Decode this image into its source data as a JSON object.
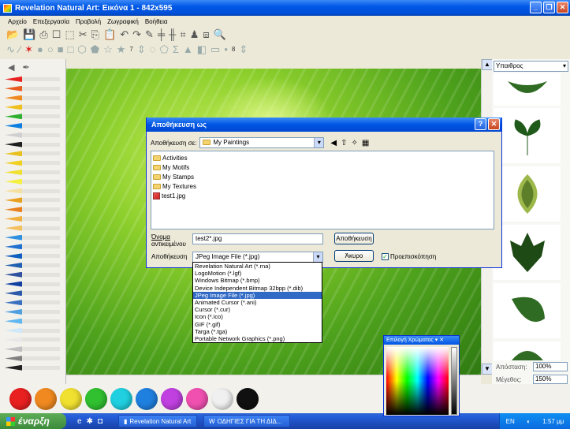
{
  "window": {
    "title": "Revelation Natural Art: Εικόνα 1 - 842x595"
  },
  "menu": [
    "Αρχείο",
    "Επεξεργασία",
    "Προβολή",
    "Ζωγραφική",
    "Βοήθεια"
  ],
  "toolbar2": {
    "spin_value": "7",
    "brush_size": "8"
  },
  "right_panel": {
    "category": "Υπαιθρος",
    "distance_label": "Απόσταση:",
    "distance_value": "100%",
    "size_label": "Μέγεθος:",
    "size_value": "150%"
  },
  "dialog": {
    "title": "Αποθήκευση ως",
    "look_in_label": "Αποθήκευση σε:",
    "look_in_value": "My Paintings",
    "files": [
      {
        "name": "Activities",
        "type": "folder"
      },
      {
        "name": "My Motifs",
        "type": "folder"
      },
      {
        "name": "My Stamps",
        "type": "folder"
      },
      {
        "name": "My Textures",
        "type": "folder"
      },
      {
        "name": "test1.jpg",
        "type": "image"
      }
    ],
    "filename_label_1": "Όνομα",
    "filename_label_2": "αντικειμένου",
    "filename_value": "test2*.jpg",
    "filetype_label": "Αποθήκευση",
    "filetype_value": "JPeg Image File (*.jpg)",
    "save_button": "Αποθήκευση",
    "cancel_button": "Άκυρο",
    "preview_label": "Προεπισκόπηση",
    "preview_checked": true
  },
  "filetype_options": [
    "Revelation Natural Art (*.rna)",
    "LogoMotion (*.lgf)",
    "Windows Bitmap (*.bmp)",
    "Device Independent Bitmap 32bpp (*.dib)",
    "JPeg Image File (*.jpg)",
    "Animated Cursor (*.ani)",
    "Cursor (*.cur)",
    "Icon (*.ico)",
    "GIF (*.gif)",
    "Targa (*.tga)",
    "Portable Network Graphics (*.png)"
  ],
  "filetype_selected_index": 4,
  "color_picker": {
    "title": "Επιλογή Χρώματος"
  },
  "pencil_colors": [
    "#e82020",
    "#e85a20",
    "#f08a20",
    "#f0c020",
    "#30b030",
    "#1080e0",
    "#d0d0d0",
    "#202020",
    "#e8c020",
    "#f0d020",
    "#f0e030",
    "#f4f040",
    "#f4e0a0",
    "#e8a020",
    "#e88020",
    "#f0b040",
    "#f4c060",
    "#3090e0",
    "#2070d0",
    "#1060c0",
    "#2060b0",
    "#3050a0",
    "#1040a0",
    "#2a5aa8",
    "#3a70c0",
    "#50a0e0",
    "#60b8f0",
    "#d0e8f8",
    "#e8e8e8",
    "#c0c0c0",
    "#808080",
    "#202020"
  ],
  "swatches": [
    "#e82020",
    "#f08a20",
    "#f0e030",
    "#30c030",
    "#20d0e0",
    "#2080e0",
    "#c040e0",
    "#f050b0",
    "#f0f0f0",
    "#101010"
  ],
  "taskbar": {
    "start": "έναρξη",
    "task1": "Revelation Natural Art",
    "task2": "ΟΔΗΓΙΕΣ ΓΙΑ ΤΗ ΔΙΔ...",
    "lang": "EN",
    "clock": "1:57 μμ"
  }
}
